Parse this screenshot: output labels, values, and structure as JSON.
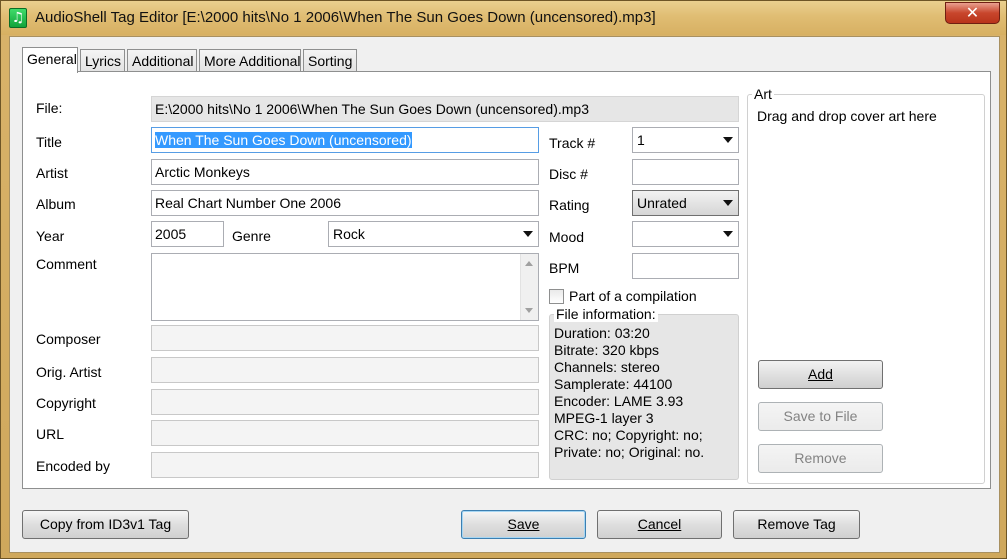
{
  "window": {
    "title": "AudioShell Tag Editor [E:\\2000 hits\\No 1 2006\\When The Sun Goes Down (uncensored).mp3]",
    "close_glyph": "✕"
  },
  "tabs": [
    {
      "label": "General"
    },
    {
      "label": "Lyrics"
    },
    {
      "label": "Additional"
    },
    {
      "label": "More Additional"
    },
    {
      "label": "Sorting"
    }
  ],
  "form": {
    "file_label": "File:",
    "file_value": "E:\\2000 hits\\No 1 2006\\When The Sun Goes Down (uncensored).mp3",
    "title_label": "Title",
    "title_value": "When The Sun Goes Down (uncensored)",
    "artist_label": "Artist",
    "artist_value": "Arctic Monkeys",
    "album_label": "Album",
    "album_value": "Real Chart Number One 2006",
    "year_label": "Year",
    "year_value": "2005",
    "genre_label": "Genre",
    "genre_value": "Rock",
    "comment_label": "Comment",
    "comment_value": "",
    "composer_label": "Composer",
    "composer_value": "",
    "orig_artist_label": "Orig. Artist",
    "orig_artist_value": "",
    "copyright_label": "Copyright",
    "copyright_value": "",
    "url_label": "URL",
    "url_value": "",
    "encoded_by_label": "Encoded by",
    "encoded_by_value": ""
  },
  "right": {
    "track_label": "Track #",
    "track_value": "1",
    "disc_label": "Disc #",
    "disc_value": "",
    "rating_label": "Rating",
    "rating_value": "Unrated",
    "mood_label": "Mood",
    "mood_value": "",
    "bpm_label": "BPM",
    "bpm_value": "",
    "compilation_label": "Part of a compilation",
    "compilation_checked": false
  },
  "file_info": {
    "title": "File information:",
    "lines": [
      "Duration: 03:20",
      "Bitrate: 320 kbps",
      "Channels: stereo",
      "Samplerate: 44100",
      "Encoder: LAME 3.93",
      "MPEG-1 layer 3",
      "CRC: no; Copyright: no;",
      "Private: no; Original: no."
    ]
  },
  "art": {
    "title": "Art",
    "hint": "Drag and drop cover art here",
    "add_label": "Add",
    "save_label": "Save to File",
    "remove_label": "Remove"
  },
  "bottom": {
    "copy_label": "Copy from ID3v1 Tag",
    "save_label": "Save",
    "cancel_label": "Cancel",
    "remove_tag_label": "Remove Tag"
  },
  "colors": {
    "title_bar": "#e0bd73",
    "close_button": "#c8462c",
    "selection": "#3399ff",
    "app_icon": "#1fbf4b"
  },
  "icons": {
    "app": "music-note-icon",
    "close": "close-icon"
  }
}
